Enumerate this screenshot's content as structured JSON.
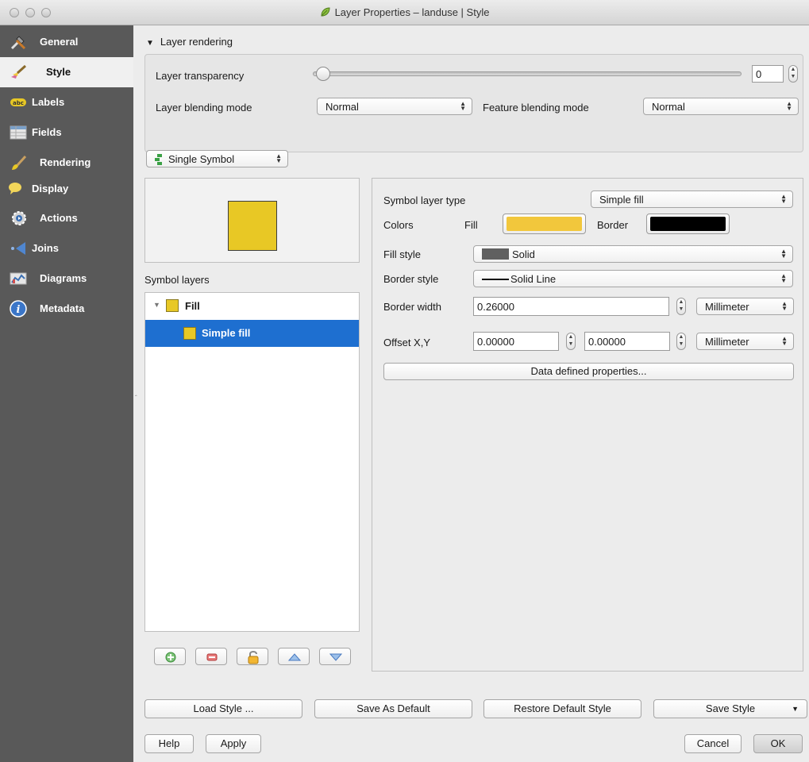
{
  "window": {
    "title": "Layer Properties – landuse | Style"
  },
  "sidebar": {
    "items": [
      {
        "label": "General",
        "icon": "tools-icon"
      },
      {
        "label": "Style",
        "icon": "paintbrush-icon",
        "active": true
      },
      {
        "label": "Labels",
        "icon": "labels-icon"
      },
      {
        "label": "Fields",
        "icon": "table-icon"
      },
      {
        "label": "Rendering",
        "icon": "brush-icon"
      },
      {
        "label": "Display",
        "icon": "speech-bubble-icon"
      },
      {
        "label": "Actions",
        "icon": "gear-icon"
      },
      {
        "label": "Joins",
        "icon": "join-arrow-icon"
      },
      {
        "label": "Diagrams",
        "icon": "chart-icon"
      },
      {
        "label": "Metadata",
        "icon": "info-icon"
      }
    ]
  },
  "layer_rendering": {
    "title": "Layer rendering",
    "transparency_label": "Layer transparency",
    "transparency_value": "0",
    "blending_label": "Layer blending mode",
    "blending_value": "Normal",
    "feature_blending_label": "Feature blending mode",
    "feature_blending_value": "Normal"
  },
  "renderer": {
    "value": "Single Symbol"
  },
  "symbol_layers": {
    "title": "Symbol layers",
    "root": "Fill",
    "child": "Simple fill"
  },
  "properties": {
    "symbol_layer_type_label": "Symbol layer type",
    "symbol_layer_type_value": "Simple fill",
    "colors_label": "Colors",
    "fill_label": "Fill",
    "fill_color": "#f2c73c",
    "border_label": "Border",
    "border_color": "#000000",
    "fill_style_label": "Fill style",
    "fill_style_value": "Solid",
    "border_style_label": "Border style",
    "border_style_value": "Solid Line",
    "border_width_label": "Border width",
    "border_width_value": "0.26000",
    "border_width_unit": "Millimeter",
    "offset_label": "Offset X,Y",
    "offset_x": "0.00000",
    "offset_y": "0.00000",
    "offset_unit": "Millimeter",
    "data_defined": "Data defined properties..."
  },
  "buttons": {
    "load_style": "Load Style ...",
    "save_default": "Save As Default",
    "restore_default": "Restore Default Style",
    "save_style": "Save Style",
    "help": "Help",
    "apply": "Apply",
    "cancel": "Cancel",
    "ok": "OK"
  },
  "colors": {
    "accent": "#1e6fd0",
    "sidebar": "#595959",
    "symbol": "#e8c825"
  }
}
